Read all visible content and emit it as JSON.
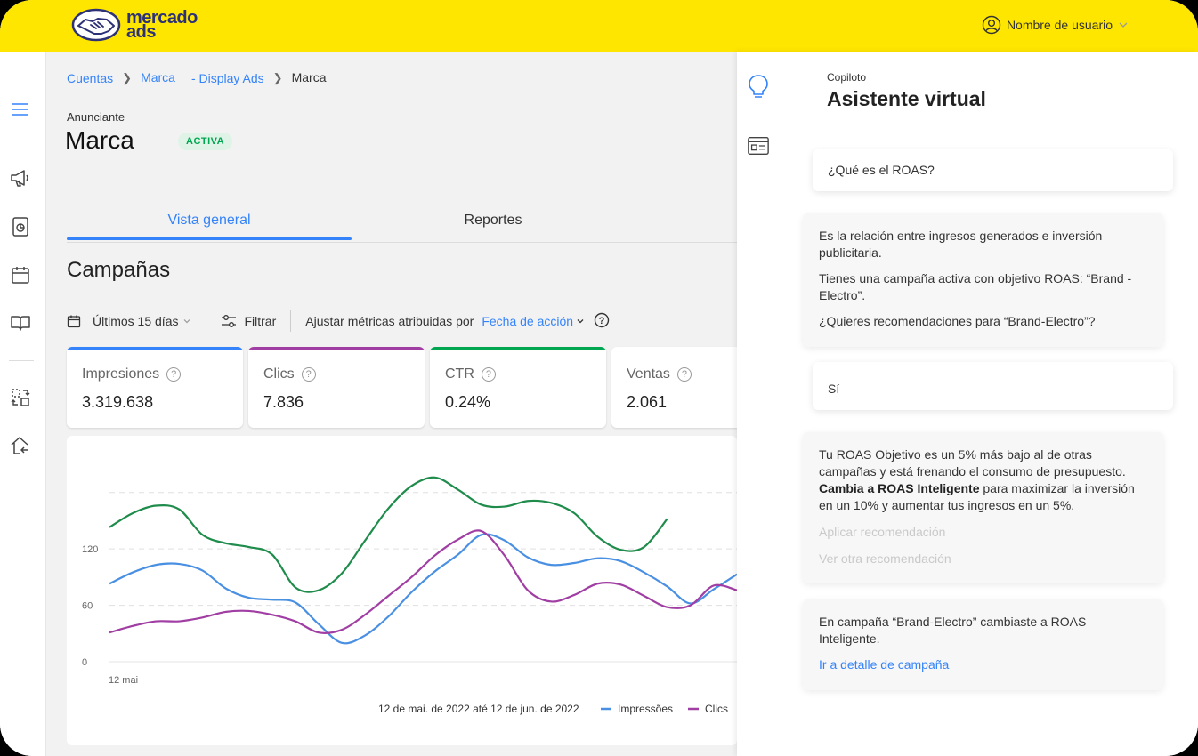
{
  "header": {
    "logo_line1": "mercado",
    "logo_line2": "ads",
    "user_name": "Nombre de usuario",
    "brand_color": "#ffe600"
  },
  "breadcrumb": {
    "items": [
      "Cuentas",
      "Marca",
      "- Display Ads"
    ],
    "current": "Marca"
  },
  "advertiser": {
    "label": "Anunciante",
    "name": "Marca",
    "status": "ACTIVA"
  },
  "tabs": [
    {
      "label": "Vista general",
      "active": true
    },
    {
      "label": "Reportes",
      "active": false
    }
  ],
  "section_title": "Campañas",
  "filters": {
    "date_range": "Últimos 15 días",
    "filter_label": "Filtrar",
    "attribution_label": "Ajustar métricas atribuidas por",
    "attribution_value": "Fecha de acción"
  },
  "metrics": [
    {
      "label": "Impresiones",
      "value": "3.319.638",
      "color": "#3483fa"
    },
    {
      "label": "Clics",
      "value": "7.836",
      "color": "#a03ea3"
    },
    {
      "label": "CTR",
      "value": "0.24%",
      "color": "#00a650"
    },
    {
      "label": "Ventas",
      "value": "2.061",
      "color": "#3483fa"
    }
  ],
  "chart_data": {
    "type": "line",
    "y_ticks": [
      "0",
      "60",
      "120"
    ],
    "ylim": [
      0,
      210
    ],
    "x_first_label": "12 mai",
    "x": [
      0,
      1,
      2,
      3,
      4,
      5,
      6,
      7,
      8,
      9,
      10,
      11,
      12,
      13,
      14,
      15,
      16,
      17,
      18,
      19,
      20,
      21,
      22,
      23,
      24,
      25,
      26,
      27,
      28,
      29,
      30,
      31
    ],
    "date_range_label": "12 de mai. de 2022 até 12 de jun. de 2022",
    "grid": true,
    "series": [
      {
        "name": "Impressões",
        "color": "#4a90e2",
        "values": [
          83,
          95,
          103,
          104,
          97,
          78,
          68,
          66,
          63,
          40,
          20,
          28,
          48,
          74,
          96,
          114,
          135,
          129,
          111,
          103,
          105,
          110,
          107,
          95,
          80,
          62,
          77,
          93
        ]
      },
      {
        "name": "Clics",
        "color": "#a03ea3",
        "values": [
          31,
          38,
          43,
          43,
          47,
          53,
          54,
          50,
          43,
          31,
          34,
          50,
          70,
          90,
          113,
          130,
          139,
          113,
          76,
          64,
          71,
          83,
          82,
          70,
          58,
          60,
          81,
          76
        ]
      },
      {
        "name": "",
        "color": "#1f8c4c",
        "values": [
          143,
          158,
          166,
          162,
          135,
          126,
          122,
          114,
          79,
          76,
          94,
          129,
          163,
          187,
          196,
          183,
          167,
          165,
          171,
          169,
          158,
          133,
          119,
          122,
          152
        ]
      }
    ]
  },
  "copilot": {
    "eyebrow": "Copiloto",
    "title": "Asistente virtual",
    "messages": [
      {
        "role": "user",
        "text": "¿Qué es el ROAS?"
      },
      {
        "role": "bot",
        "lines": [
          "Es la relación entre ingresos generados e inversión publicitaria.",
          "Tienes una campaña activa con objetivo ROAS: “Brand - Electro”.",
          "¿Quieres recomendaciones para “Brand-Electro”?"
        ]
      },
      {
        "role": "user",
        "text": "Sí"
      },
      {
        "role": "bot",
        "text_a": "Tu ROAS Objetivo es un 5% más bajo al de otras campañas y está frenando el consumo de presupuesto.",
        "bold": "Cambia a ROAS Inteligente",
        "text_b": "para maximizar la inversión en un 10% y aumentar tus ingresos en un 5%.",
        "action_1": "Aplicar recomendación",
        "action_2": "Ver otra recomendación"
      },
      {
        "role": "bot",
        "text": "En campaña “Brand-Electro” cambiaste a ROAS Inteligente.",
        "link": "Ir a detalle de campaña"
      }
    ]
  }
}
